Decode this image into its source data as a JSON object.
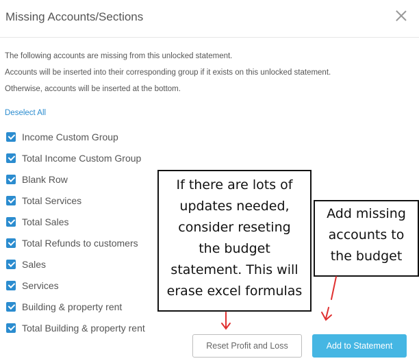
{
  "dialog": {
    "title": "Missing Accounts/Sections",
    "close_icon": "close-icon"
  },
  "description": {
    "line1": "The following accounts are missing from this unlocked statement.",
    "line2": "Accounts will be inserted into their corresponding group if it exists on this unlocked statement.",
    "line3": "Otherwise, accounts will be inserted at the bottom."
  },
  "deselect_all": "Deselect All",
  "items": [
    {
      "label": "Income Custom Group",
      "checked": true
    },
    {
      "label": "Total Income Custom Group",
      "checked": true
    },
    {
      "label": "Blank Row",
      "checked": true
    },
    {
      "label": "Total Services",
      "checked": true
    },
    {
      "label": "Total Sales",
      "checked": true
    },
    {
      "label": "Total Refunds to customers",
      "checked": true
    },
    {
      "label": "Sales",
      "checked": true
    },
    {
      "label": "Services",
      "checked": true
    },
    {
      "label": "Building & property rent",
      "checked": true
    },
    {
      "label": "Total Building & property rent",
      "checked": true
    }
  ],
  "buttons": {
    "reset": "Reset Profit and Loss",
    "add": "Add to Statement"
  },
  "annotations": {
    "left_lines": [
      "If there are lots of",
      "updates needed,",
      "consider reseting",
      "the budget",
      "statement. This will",
      "erase excel formulas"
    ],
    "right_lines": [
      "Add missing",
      "accounts to",
      "the budget"
    ]
  },
  "colors": {
    "accent": "#2b8ccf",
    "primary_button": "#45b6e3",
    "arrow": "#e03030"
  }
}
